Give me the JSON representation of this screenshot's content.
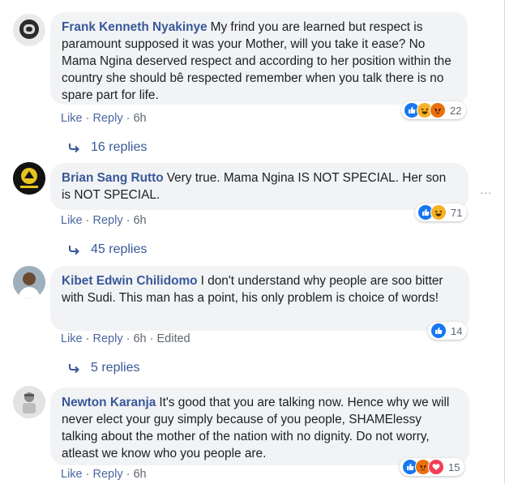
{
  "comments": [
    {
      "author": "Frank Kenneth Nyakinye",
      "text": "My frind you are learned but respect is paramount supposed it was your Mother, will you take it ease? No Mama Ngina deserved respect and according to her position within the country she should bê respected remember when you talk there is no spare part for life.",
      "reaction_icons": [
        "like-icon",
        "haha-icon",
        "angry-icon"
      ],
      "reaction_count": "22",
      "like_label": "Like",
      "reply_label": "Reply",
      "time": "6h",
      "edited": "",
      "replies": "16 replies"
    },
    {
      "author": "Brian Sang Rutto",
      "text": "Very true. Mama Ngina IS NOT SPECIAL. Her son is NOT SPECIAL.",
      "reaction_icons": [
        "like-icon",
        "haha-icon"
      ],
      "reaction_count": "71",
      "like_label": "Like",
      "reply_label": "Reply",
      "time": "6h",
      "edited": "",
      "replies": "45 replies",
      "more_options": "..."
    },
    {
      "author": "Kibet Edwin Chilidomo",
      "text": "I don't understand why people are soo bitter with Sudi. This man has a point, his only problem is choice of words!",
      "reaction_icons": [
        "like-icon"
      ],
      "reaction_count": "14",
      "like_label": "Like",
      "reply_label": "Reply",
      "time": "6h",
      "edited": "Edited",
      "replies": "5 replies"
    },
    {
      "author": "Newton Karanja",
      "text": "It's good that you are talking now. Hence why we will never elect your guy simply because of you people, SHAMElessy talking about the mother of the nation with no dignity. Do not worry, atleast we know who you people are.",
      "reaction_icons": [
        "like-icon",
        "angry-icon",
        "love-icon"
      ],
      "reaction_count": "15",
      "like_label": "Like",
      "reply_label": "Reply",
      "time": "6h",
      "edited": ""
    }
  ],
  "colors": {
    "author": "#385898",
    "bubble": "#f2f3f5",
    "like": "#1877f2",
    "haha": "#f7b125",
    "angry": "#e9710f",
    "love": "#f33e58"
  }
}
